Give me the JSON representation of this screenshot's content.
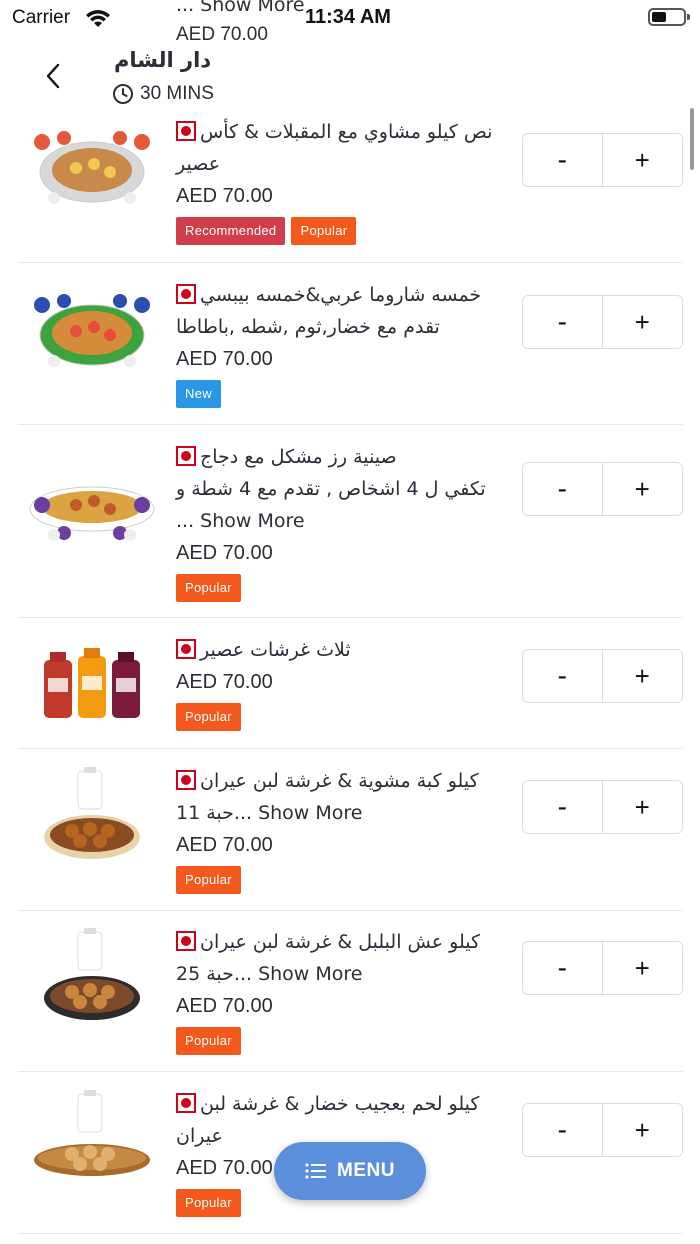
{
  "status_bar": {
    "carrier": "Carrier",
    "time": "11:34 AM"
  },
  "header": {
    "restaurant_name": "دار الشام",
    "eta": "30 MINS",
    "behind_text_1": "... Show More",
    "behind_text_2": "AED 70.00"
  },
  "colors": {
    "recommended": "#d13d4a",
    "popular": "#f3591d",
    "new": "#2a96e8",
    "fab": "#5b8fdc",
    "veg_mark": "#d0021b"
  },
  "items": [
    {
      "title_lines": [
        "نص كيلو مشاوي مع المقبلات & كأس",
        "عصير"
      ],
      "price": "AED 70.00",
      "badges": [
        "Recommended",
        "Popular"
      ]
    },
    {
      "title_lines": [
        "خمسه شاروما عربي&خمسه بيبسي",
        "تقدم مع خضار,ثوم ,شطه ,باطاطا"
      ],
      "price": "AED 70.00",
      "badges": [
        "New"
      ]
    },
    {
      "title_lines": [
        "صينية رز مشكل مع دجاج",
        "تكفي ل 4 اشخاص , تقدم مع 4 شطة و",
        "... Show More"
      ],
      "price": "AED 70.00",
      "badges": [
        "Popular"
      ]
    },
    {
      "title_lines": [
        "ثلاث غرشات عصير"
      ],
      "price": "AED 70.00",
      "badges": [
        "Popular"
      ]
    },
    {
      "title_lines": [
        "كيلو كبة مشوية & غرشة لبن عيران",
        "حبة 11... Show More"
      ],
      "price": "AED 70.00",
      "badges": [
        "Popular"
      ]
    },
    {
      "title_lines": [
        "كيلو عش البلبل & غرشة لبن عيران",
        "حبة 25... Show More"
      ],
      "price": "AED 70.00",
      "badges": [
        "Popular"
      ]
    },
    {
      "title_lines": [
        "كيلو لحم بعجيب خضار & غرشة لبن",
        "عيران"
      ],
      "price": "AED 70.00",
      "badges": [
        "Popular"
      ]
    }
  ],
  "stepper": {
    "minus": "-",
    "plus": "+"
  },
  "menu_button": {
    "label": "MENU"
  }
}
